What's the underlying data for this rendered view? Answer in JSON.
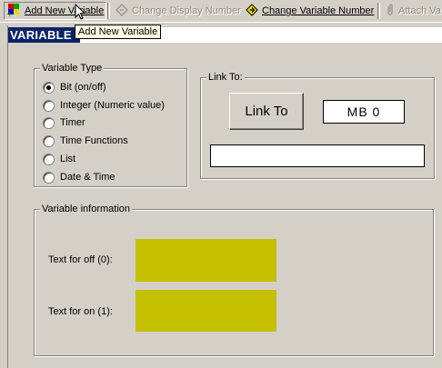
{
  "toolbar": {
    "add_label": "Add New Variable",
    "change_display_label": "Change Display Number",
    "change_variable_label": "Change Variable Number",
    "attach_label": "Attach Va"
  },
  "tooltip": "Add New Variable",
  "window": {
    "title": "VARIABLE"
  },
  "variable_type": {
    "title": "Variable Type",
    "options": [
      "Bit (on/off)",
      "Integer (Numeric value)",
      "Timer",
      "Time Functions",
      "List",
      "Date & Time"
    ],
    "selected": "Bit (on/off)"
  },
  "link_to": {
    "title": "Link To:",
    "button_label": "Link To",
    "address_value": "MB  0",
    "description_value": ""
  },
  "variable_info": {
    "title": "Variable information",
    "off_label": "Text for off (0):",
    "on_label": "Text for on (1):",
    "swatch_color": "#c4c000"
  },
  "icons": [
    "add-variable-icon",
    "change-display-icon",
    "change-variable-icon",
    "attach-icon",
    "mouse-cursor-icon"
  ]
}
